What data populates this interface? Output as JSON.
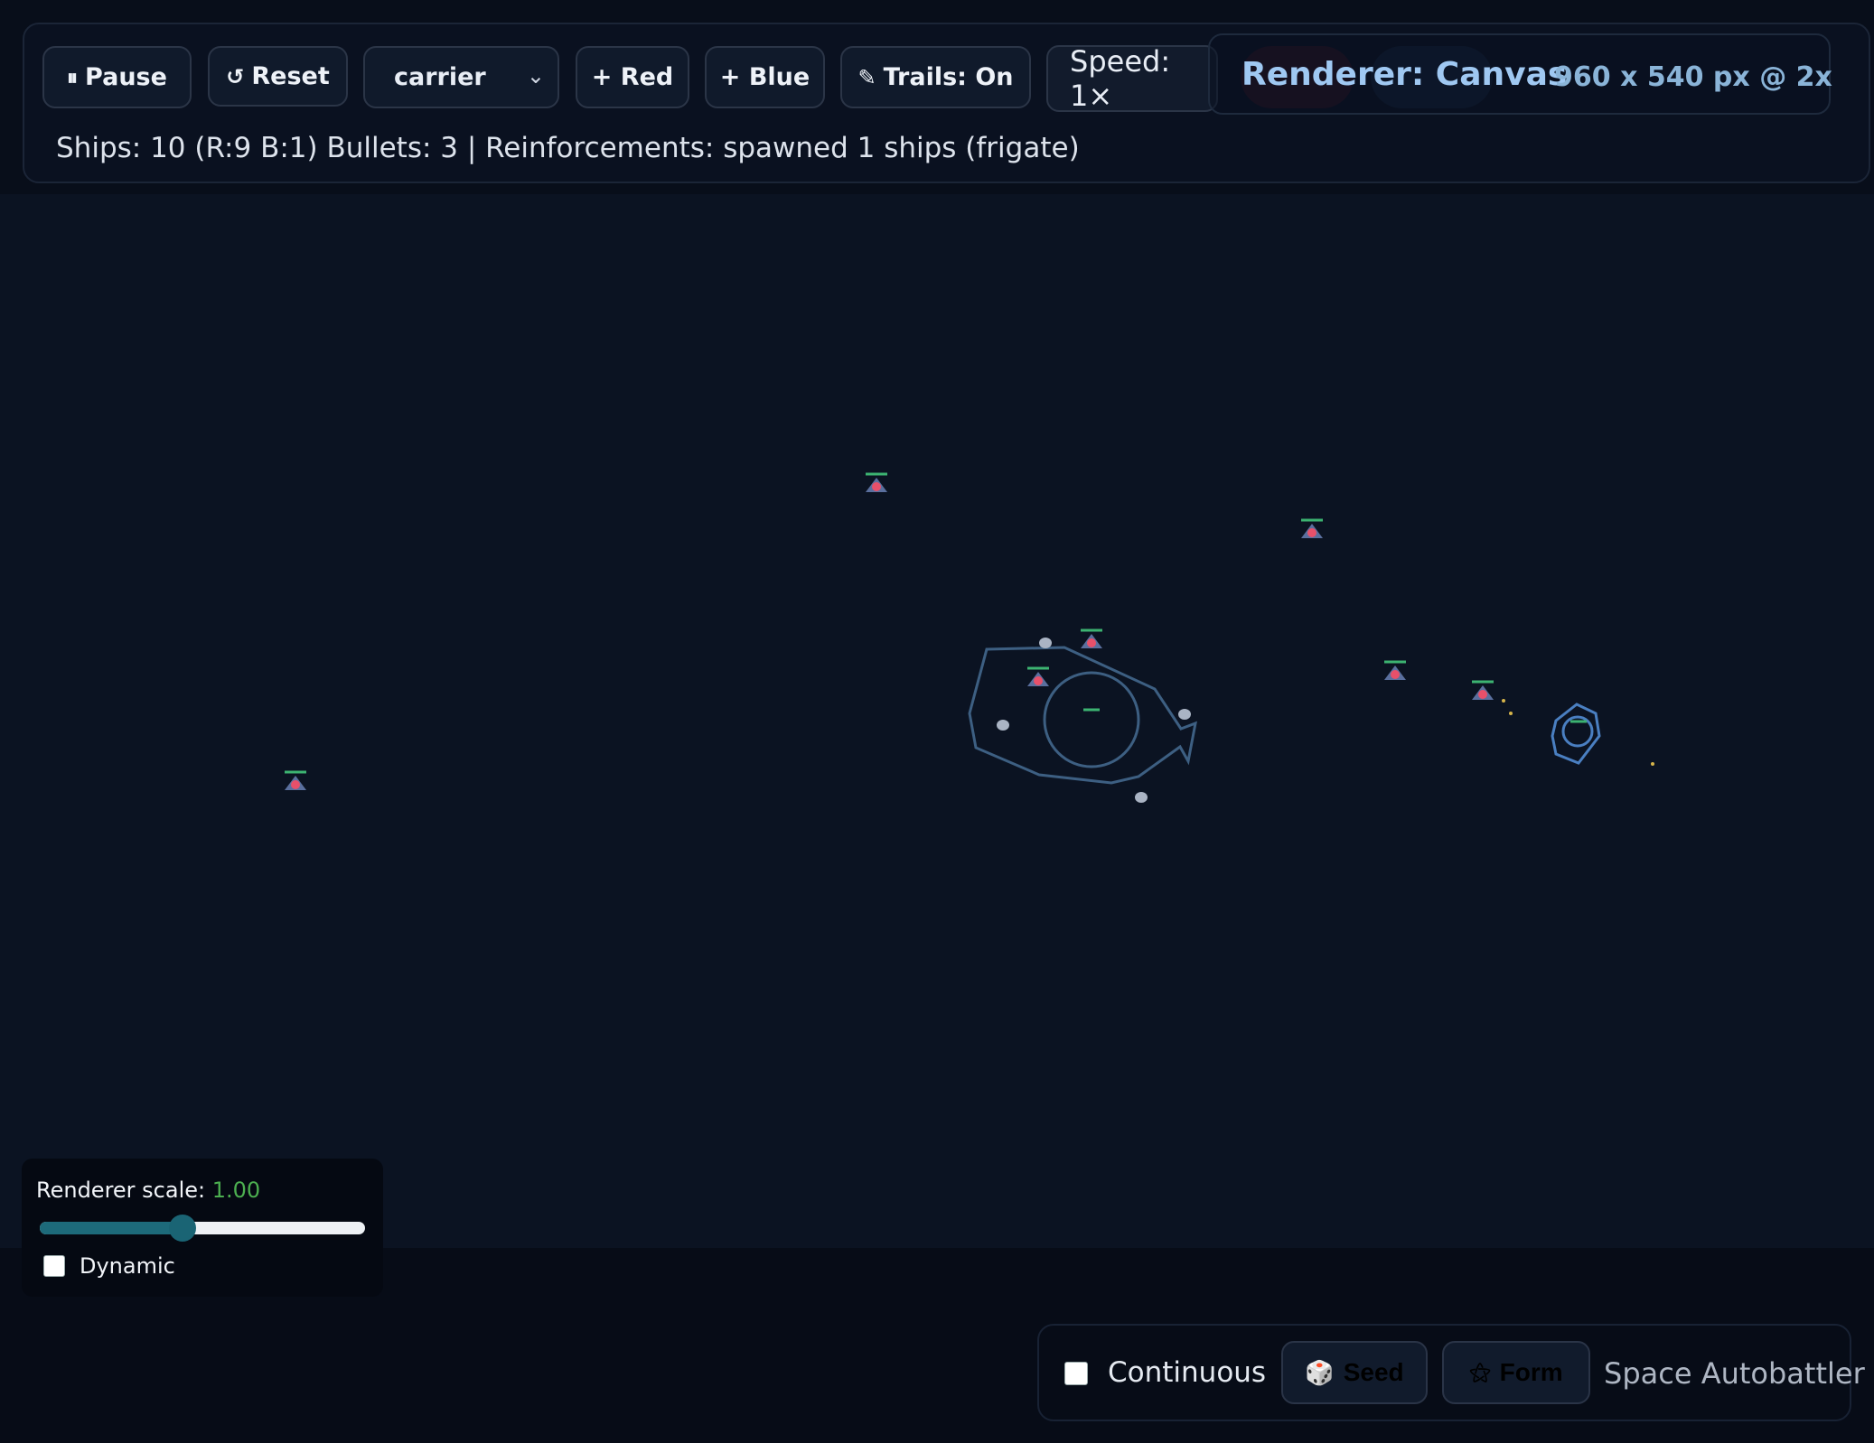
{
  "toolbar": {
    "pause_label": "Pause",
    "pause_icon": "⏸",
    "reset_label": "Reset",
    "reset_icon": "↺",
    "ship_type_selected": "carrier",
    "add_red_label": "+ Red",
    "add_blue_label": "+ Blue",
    "trails_label": "Trails: On",
    "trails_icon": "✎",
    "speed_label": "Speed: 1×",
    "renderer_label": "Renderer: Canvas",
    "resolution": "960 x 540 px @ 2x"
  },
  "status": {
    "text": "Ships: 10 (R:9 B:1) Bullets: 3 | Reinforcements: spawned 1 ships (frigate)"
  },
  "scale_panel": {
    "label": "Renderer scale:",
    "value": "1.00",
    "slider_fraction": 0.44,
    "dynamic_label": "Dynamic",
    "dynamic_checked": false
  },
  "bottom": {
    "continuous_label": "Continuous",
    "continuous_checked": false,
    "seed_label": "Seed",
    "form_label": "Form",
    "app_title": "Space Autobattler"
  },
  "colors": {
    "background": "#0b1322",
    "ship_outline": "#3b6fa0",
    "health_bar": "#3cb371",
    "red_team": "#e8506a",
    "blue_team": "#4a7fc1",
    "scale_value": "#4caf50"
  }
}
